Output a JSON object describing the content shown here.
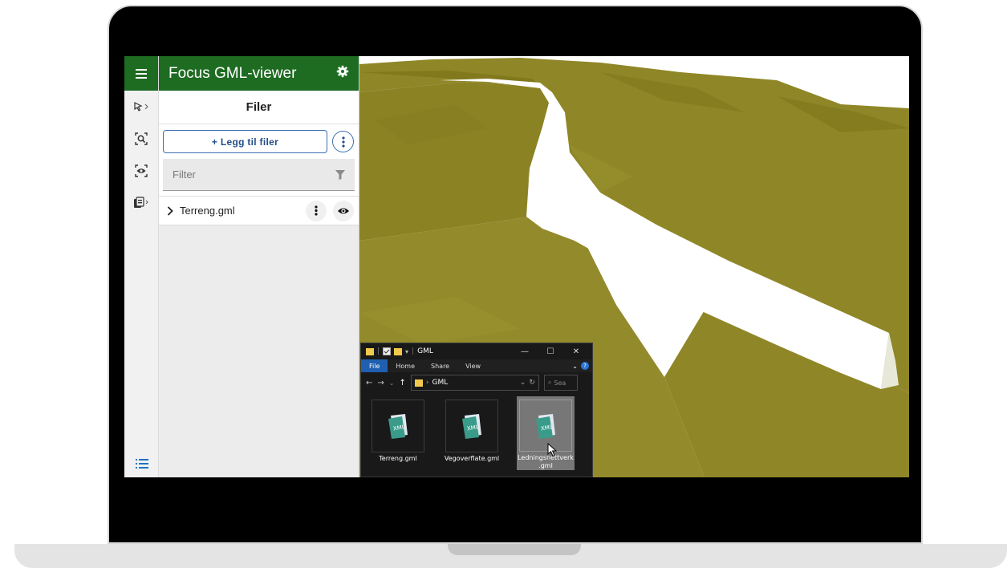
{
  "app": {
    "title": "Focus GML-viewer",
    "section_title": "Filer",
    "add_files_label": "+ Legg til filer",
    "filter_placeholder": "Filter",
    "files": [
      {
        "name": "Terreng.gml"
      }
    ],
    "accent": "#1e6b22",
    "link_color": "#244e8a",
    "icons": {
      "menu": "menu-icon",
      "settings": "gear-icon",
      "select": "cursor-select-icon",
      "zoom": "zoom-target-icon",
      "visibility": "eye-icon",
      "layers": "layers-icon",
      "list": "list-icon",
      "more": "more-vertical-icon",
      "filter": "funnel-icon",
      "expand": "chevron-right-icon"
    }
  },
  "viewport": {
    "terrain_color": "#8f8627",
    "road_color": "#ffffff"
  },
  "explorer": {
    "title": "GML",
    "tabs": [
      "File",
      "Home",
      "Share",
      "View"
    ],
    "active_tab": "File",
    "path": "GML",
    "search_placeholder": "Sea",
    "files": [
      {
        "name": "Terreng.gml"
      },
      {
        "name": "Vegoverflate.gml"
      },
      {
        "name": "Ledningsnettverk .gml"
      }
    ],
    "selected_file": "Ledningsnettverk .gml"
  }
}
